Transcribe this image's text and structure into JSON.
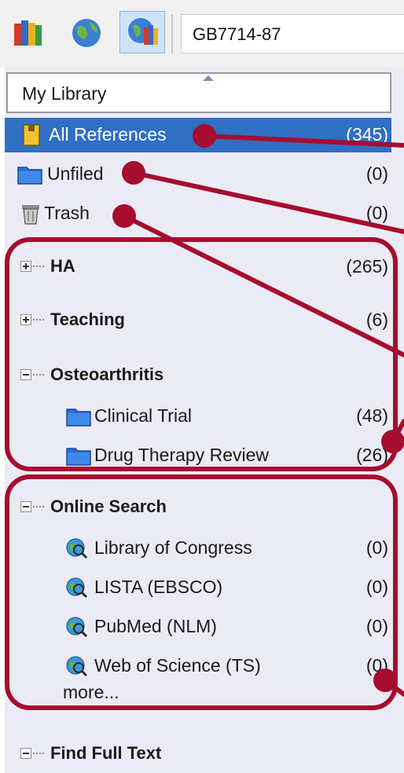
{
  "toolbar": {
    "style_name": "GB7714-87",
    "icons": [
      "local-library-icon",
      "online-search-icon",
      "integrated-library-icon"
    ]
  },
  "groups_pane": {
    "header": "My Library",
    "items": [
      {
        "label": "All References",
        "count": "(345)",
        "icon": "all-references-icon"
      },
      {
        "label": "Unfiled",
        "count": "(0)",
        "icon": "unfiled-folder-icon"
      },
      {
        "label": "Trash",
        "count": "(0)",
        "icon": "trash-icon"
      }
    ],
    "group_sets": [
      {
        "label": "HA",
        "count": "(265)",
        "expanded": false
      },
      {
        "label": "Teaching",
        "count": "(6)",
        "expanded": false
      },
      {
        "label": "Osteoarthritis",
        "expanded": true,
        "children": [
          {
            "label": "Clinical Trial",
            "count": "(48)"
          },
          {
            "label": "Drug Therapy Review",
            "count": "(26)"
          }
        ]
      }
    ],
    "online_search": {
      "label": "Online Search",
      "items": [
        {
          "label": "Library of Congress",
          "count": "(0)"
        },
        {
          "label": "LISTA (EBSCO)",
          "count": "(0)"
        },
        {
          "label": "PubMed (NLM)",
          "count": "(0)"
        },
        {
          "label": "Web of Science (TS)",
          "count": "(0)"
        }
      ],
      "more": "more..."
    },
    "find_full_text": {
      "label": "Find Full Text"
    }
  },
  "colors": {
    "selection": "#2f6fc4",
    "annotation": "#a60d2e",
    "pane_background": "#ebebf5"
  }
}
